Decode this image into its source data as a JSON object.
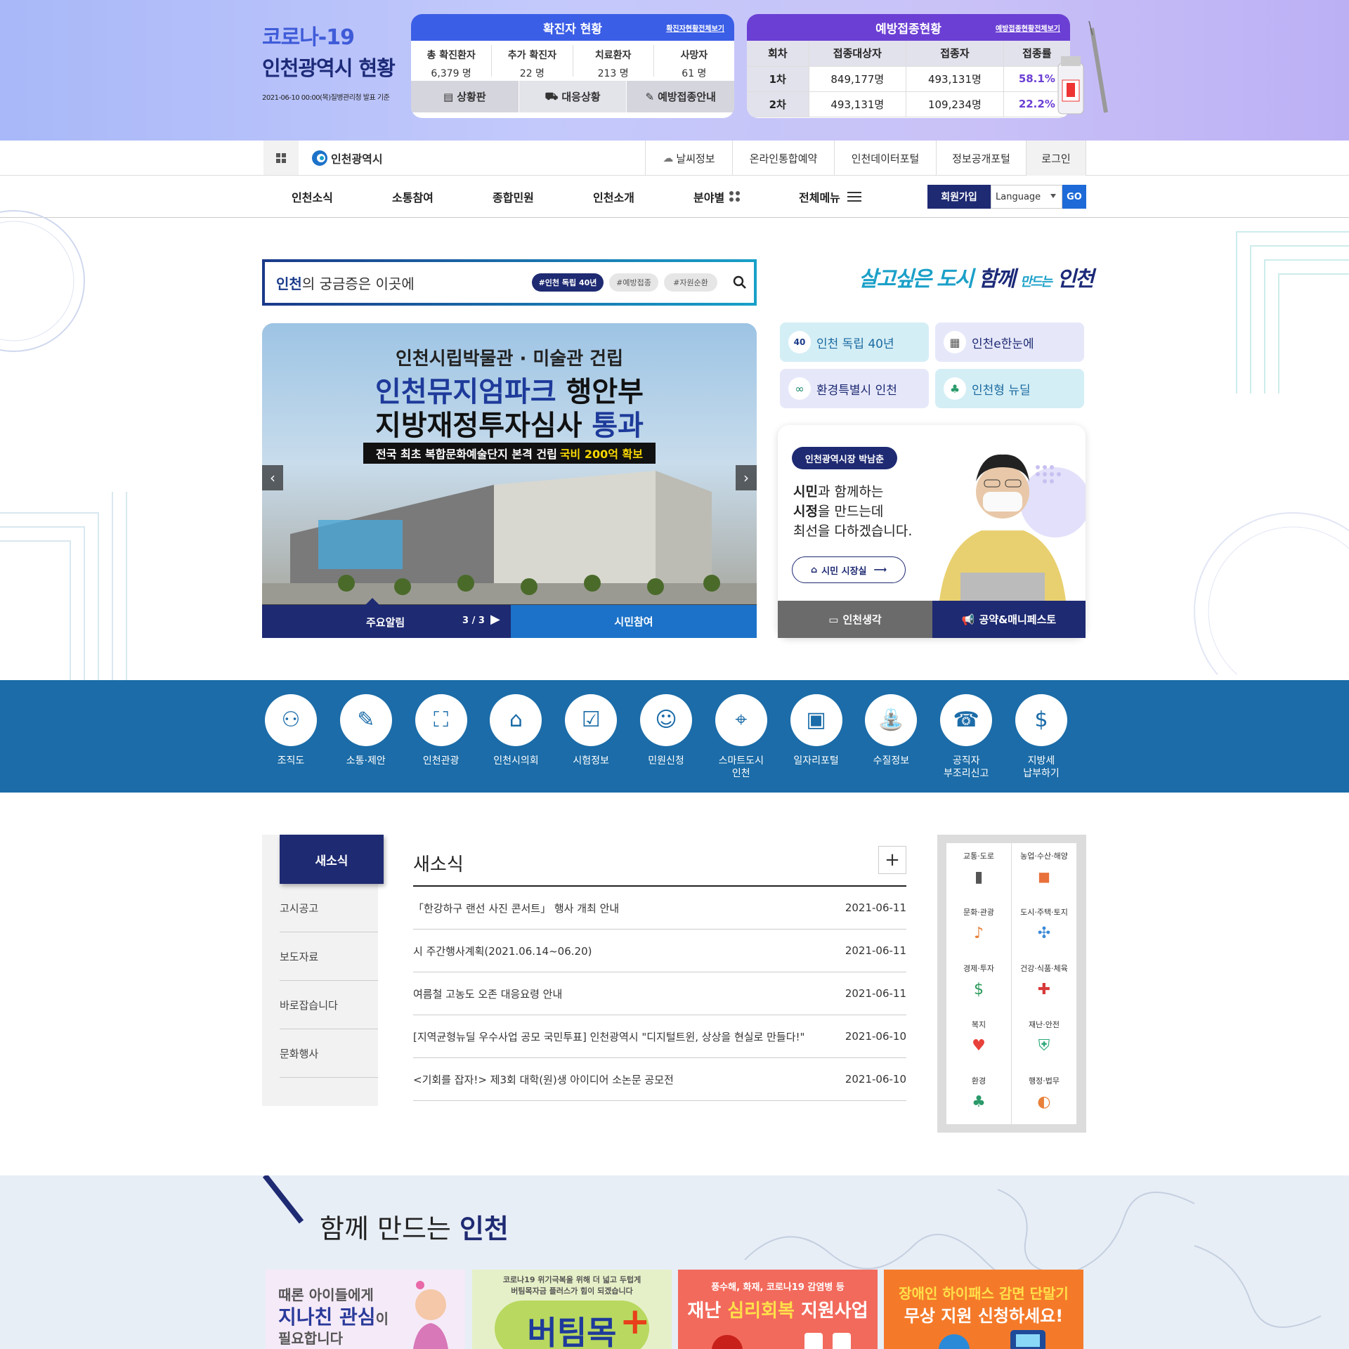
{
  "covid": {
    "title1": "코로나-19",
    "title2": "인천광역시 현황",
    "date_note": "2021-06-10 00:00(목)질병관리청 발표 기준",
    "confirmed": {
      "heading": "확진자 현황",
      "more": "확진자현황전체보기",
      "stats": [
        {
          "label": "총 확진환자",
          "value": "6,379 명"
        },
        {
          "label": "추가 확진자",
          "value": "22 명"
        },
        {
          "label": "치료환자",
          "value": "213 명"
        },
        {
          "label": "사망자",
          "value": "61 명"
        }
      ],
      "buttons": [
        "상황판",
        "대응상황",
        "예방접종안내"
      ]
    },
    "vaccine": {
      "heading": "예방접종현황",
      "more": "예방접종현황전체보기",
      "headers": [
        "회차",
        "접종대상자",
        "접종자",
        "접종률"
      ],
      "rows": [
        {
          "round": "1차",
          "target": "849,177명",
          "done": "493,131명",
          "rate": "58.1%"
        },
        {
          "round": "2차",
          "target": "493,131명",
          "done": "109,234명",
          "rate": "22.2%"
        }
      ]
    }
  },
  "util": {
    "logo": "인천광역시",
    "links": [
      "날씨정보",
      "온라인통합예약",
      "인천데이터포털",
      "정보공개포털",
      "로그인"
    ]
  },
  "gnb": {
    "items": [
      "인천소식",
      "소통참여",
      "종합민원",
      "인천소개",
      "분야별",
      "전체메뉴"
    ],
    "join": "회원가입",
    "language": "Language",
    "go": "GO"
  },
  "search": {
    "placeholder_bold": "인천",
    "placeholder_rest": "의 궁금증은 이곳에",
    "tags": [
      "#인천 독립 40년",
      "#예방접종",
      "#자원순환"
    ]
  },
  "slogan": {
    "part1": "살고싶은 도시",
    "part2": "함께",
    "part3": "만드는",
    "part4": "인천"
  },
  "banner": {
    "line1": "인천시립박물관 · 미술관 건립",
    "line2a": "인천뮤지엄파크",
    "line2b": " 행안부",
    "line3a": "지방재정투자심사 ",
    "line3b": "통과",
    "sub": "전국 최초 복합문화예술단지 본격 건립",
    "sub_em": "국비 200억 확보",
    "tab1": "주요알림",
    "counter": "3 / 3",
    "tab2": "시민참여"
  },
  "quick_links": [
    "인천 독립 40년",
    "인천e한눈에",
    "환경특별시 인천",
    "인천형 뉴딜"
  ],
  "mayor": {
    "badge": "인천광역시장 박남춘",
    "msg1a": "시민",
    "msg1b": "과 함께하는",
    "msg2a": "시정",
    "msg2b": "을 만드는데",
    "msg3": "최선을 다하겠습니다.",
    "button": "시민 시장실",
    "btn1": "인천생각",
    "btn2": "공약&매니페스토"
  },
  "services": [
    {
      "l1": "조직도",
      "l2": ""
    },
    {
      "l1": "소통·제안",
      "l2": ""
    },
    {
      "l1": "인천관광",
      "l2": ""
    },
    {
      "l1": "인천시의회",
      "l2": ""
    },
    {
      "l1": "시험정보",
      "l2": ""
    },
    {
      "l1": "민원신청",
      "l2": ""
    },
    {
      "l1": "스마트도시",
      "l2": "인천"
    },
    {
      "l1": "일자리포털",
      "l2": ""
    },
    {
      "l1": "수질정보",
      "l2": ""
    },
    {
      "l1": "공직자",
      "l2": "부조리신고"
    },
    {
      "l1": "지방세",
      "l2": "납부하기"
    }
  ],
  "news": {
    "tabs": [
      "새소식",
      "고시공고",
      "보도자료",
      "바로잡습니다",
      "문화행사"
    ],
    "title": "새소식",
    "plus": "+",
    "items": [
      {
        "title": "「한강하구 랜선 사진 콘서트」 행사 개최 안내",
        "date": "2021-06-11"
      },
      {
        "title": "시 주간행사계획(2021.06.14~06.20)",
        "date": "2021-06-11"
      },
      {
        "title": "여름철 고농도 오존 대응요령 안내",
        "date": "2021-06-11"
      },
      {
        "title": "[지역균형뉴딜 우수사업 공모 국민투표] 인천광역시 \"디지털트윈, 상상을 현실로 만들다!\"",
        "date": "2021-06-10"
      },
      {
        "title": "<기회를 잡자!> 제3회 대학(원)생 아이디어 소논문 공모전",
        "date": "2021-06-10"
      }
    ]
  },
  "categories": [
    "교통·도로",
    "농업·수산·해양",
    "문화·관광",
    "도시·주택·토지",
    "경제·투자",
    "건강·식품·체육",
    "복지",
    "재난·안전",
    "환경",
    "행정·법무"
  ],
  "together": {
    "title_a": "함께 만드는 ",
    "title_b": "인천",
    "cards": [
      {
        "l1": "때론 아이들에게",
        "l2": "지나친 관심",
        "l2b": "이",
        "l3": "필요합니다"
      },
      {
        "l1": "코로나19 위기극복을 위해 더 넓고 두텁게",
        "l2": "버팀목자금 플러스가 힘이 되겠습니다",
        "l3": "버팀목"
      },
      {
        "l1": "풍수해, 화재, 코로나19 감염병 등",
        "l2": "재난 ",
        "l2b": "심리회복",
        "l3": " 지원사업"
      },
      {
        "l1": "장애인 하이패스 감면 단말기",
        "l2": "무상 지원 신청하세요!",
        "l3": ""
      }
    ]
  },
  "colors": {
    "navy": "#1e2a72",
    "blue": "#1b6ca8",
    "purple": "#6b3fd4",
    "confirm_blue": "#3b5ee6"
  }
}
